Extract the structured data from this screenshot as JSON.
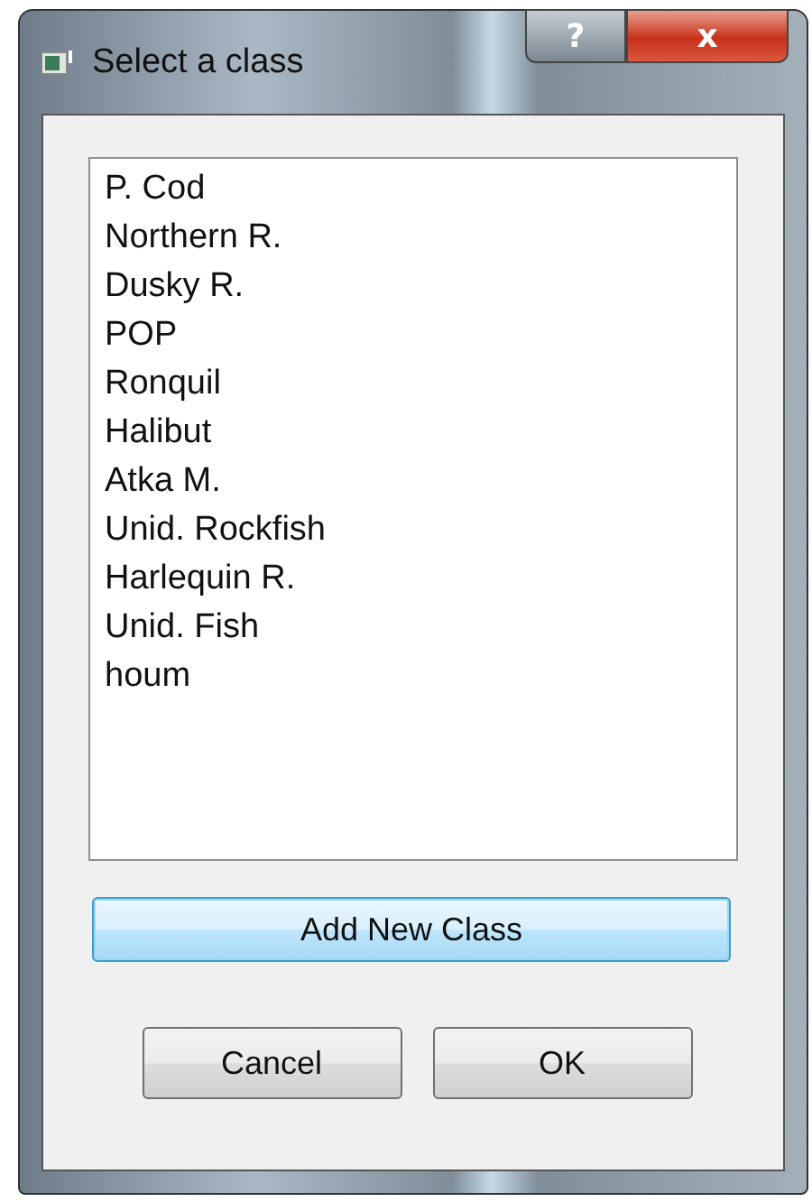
{
  "window": {
    "title": "Select a class",
    "help_button": "?",
    "close_button": "x"
  },
  "class_list": {
    "items": [
      {
        "label": "P. Cod"
      },
      {
        "label": "Northern R."
      },
      {
        "label": "Dusky R."
      },
      {
        "label": "POP"
      },
      {
        "label": "Ronquil"
      },
      {
        "label": "Halibut"
      },
      {
        "label": "Atka M."
      },
      {
        "label": "Unid. Rockfish"
      },
      {
        "label": "Harlequin R."
      },
      {
        "label": "Unid. Fish"
      },
      {
        "label": "houm"
      }
    ]
  },
  "add_button": "Add New Class",
  "buttons": [
    "Cancel",
    "OK"
  ]
}
